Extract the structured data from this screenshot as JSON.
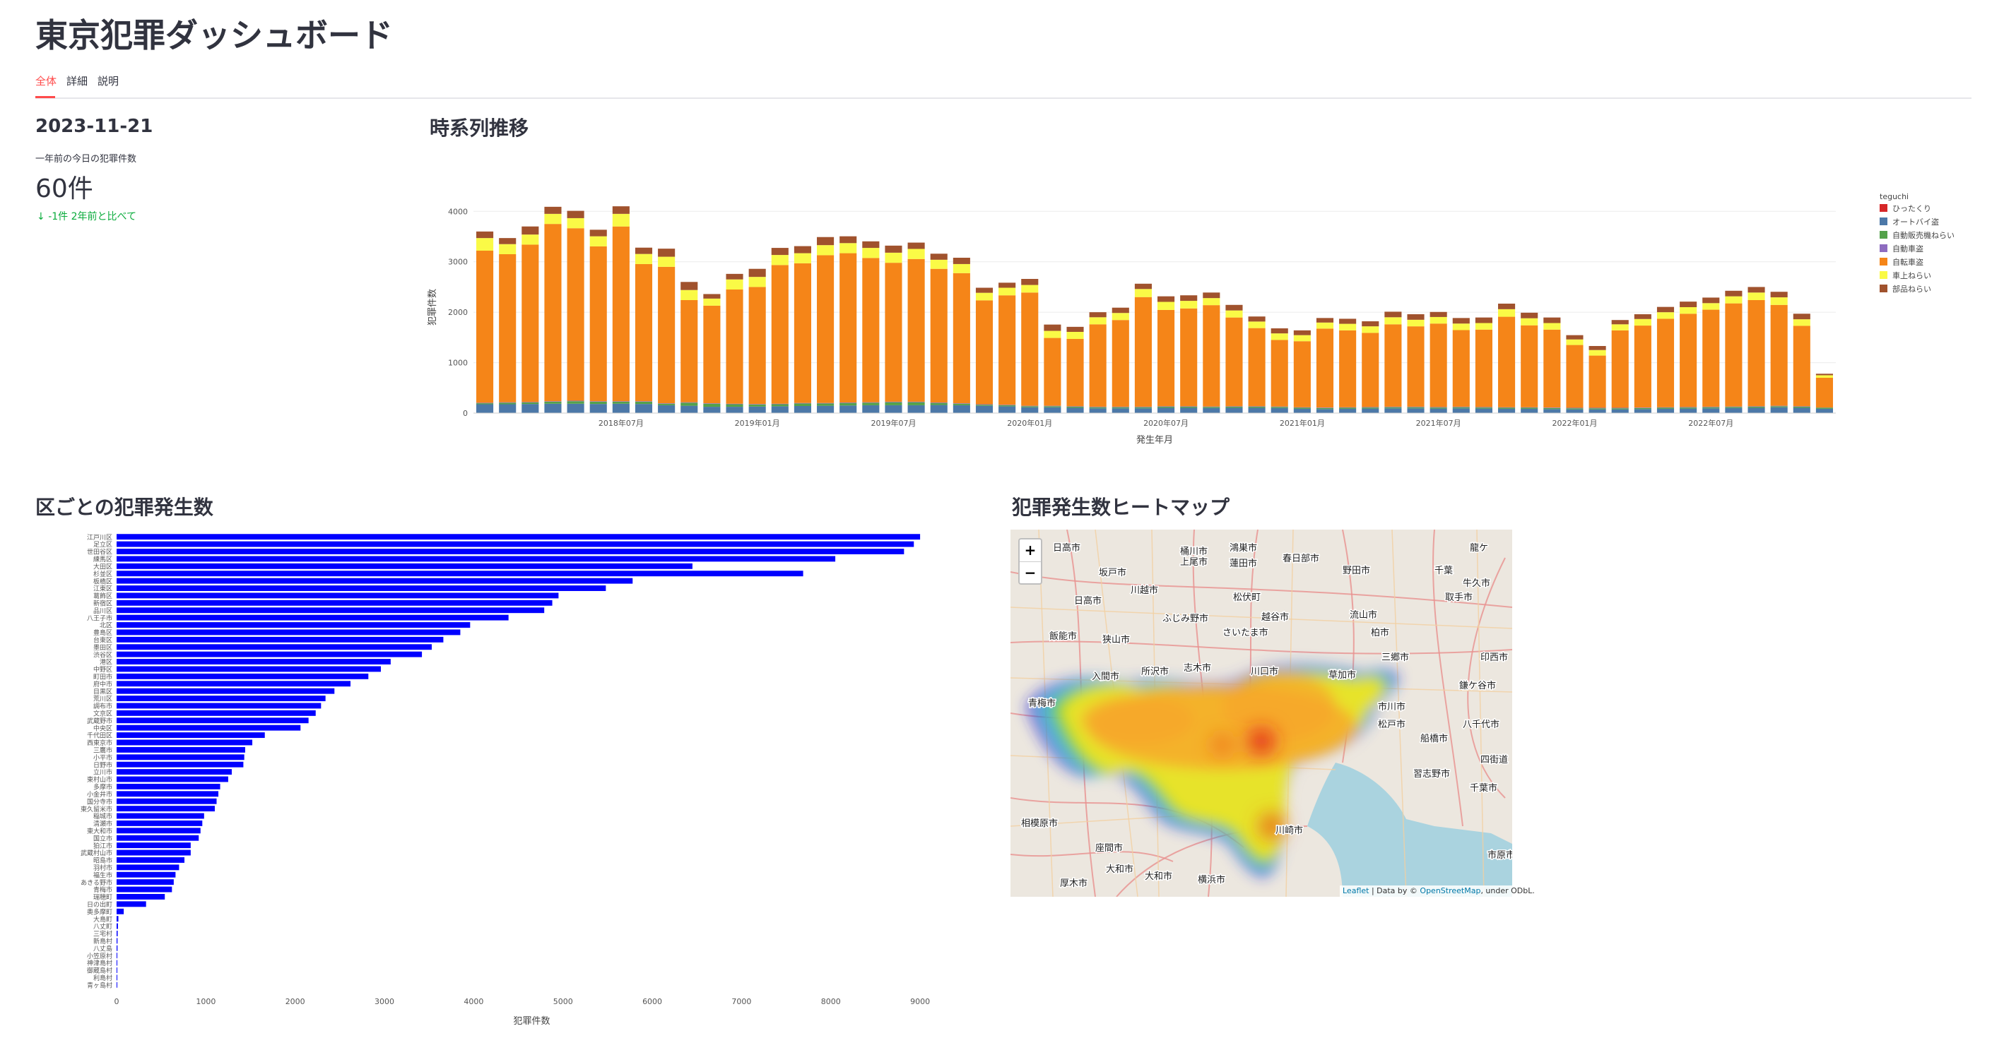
{
  "page": {
    "title": "東京犯罪ダッシュボード"
  },
  "tabs": [
    {
      "label": "全体",
      "active": true
    },
    {
      "label": "詳細",
      "active": false
    },
    {
      "label": "説明",
      "active": false
    }
  ],
  "metric": {
    "date": "2023-11-21",
    "label": "一年前の今日の犯罪件数",
    "value": "60件",
    "delta": "-1件 2年前と比べて",
    "delta_icon": "arrow-down-icon",
    "delta_color": "#09ab3b"
  },
  "sections": {
    "timeseries": "時系列推移",
    "wards": "区ごとの犯罪発生数",
    "heatmap": "犯罪発生数ヒートマップ"
  },
  "chart_data": [
    {
      "type": "bar",
      "stacked": true,
      "xlabel": "発生年月",
      "ylabel": "犯罪件数",
      "ylim": [
        0,
        4200
      ],
      "yticks": [
        0,
        1000,
        2000,
        3000,
        4000
      ],
      "xticks": [
        "2018年07月",
        "2019年01月",
        "2019年07月",
        "2020年01月",
        "2020年07月",
        "2021年01月",
        "2021年07月",
        "2022年01月",
        "2022年07月"
      ],
      "xtick_indices": [
        6,
        12,
        18,
        24,
        30,
        36,
        42,
        48,
        54
      ],
      "legend_title": "teguchi",
      "legend_position": "right",
      "categories": [
        "2018年01月",
        "2018年02月",
        "2018年03月",
        "2018年04月",
        "2018年05月",
        "2018年06月",
        "2018年07月",
        "2018年08月",
        "2018年09月",
        "2018年10月",
        "2018年11月",
        "2018年12月",
        "2019年01月",
        "2019年02月",
        "2019年03月",
        "2019年04月",
        "2019年05月",
        "2019年06月",
        "2019年07月",
        "2019年08月",
        "2019年09月",
        "2019年10月",
        "2019年11月",
        "2019年12月",
        "2020年01月",
        "2020年02月",
        "2020年03月",
        "2020年04月",
        "2020年05月",
        "2020年06月",
        "2020年07月",
        "2020年08月",
        "2020年09月",
        "2020年10月",
        "2020年11月",
        "2020年12月",
        "2021年01月",
        "2021年02月",
        "2021年03月",
        "2021年04月",
        "2021年05月",
        "2021年06月",
        "2021年07月",
        "2021年08月",
        "2021年09月",
        "2021年10月",
        "2021年11月",
        "2021年12月",
        "2022年01月",
        "2022年02月",
        "2022年03月",
        "2022年04月",
        "2022年05月",
        "2022年06月",
        "2022年07月",
        "2022年08月",
        "2022年09月",
        "2022年10月",
        "2022年11月",
        "2022年12月"
      ],
      "series": [
        {
          "name": "ひったくり",
          "color": "#d62728",
          "values": [
            5,
            5,
            5,
            5,
            5,
            5,
            5,
            5,
            5,
            5,
            5,
            5,
            5,
            5,
            5,
            5,
            5,
            5,
            5,
            5,
            5,
            5,
            5,
            5,
            5,
            5,
            5,
            5,
            5,
            5,
            5,
            5,
            5,
            5,
            5,
            5,
            5,
            5,
            5,
            5,
            5,
            5,
            5,
            5,
            5,
            5,
            5,
            5,
            5,
            5,
            5,
            5,
            5,
            5,
            5,
            5,
            5,
            5,
            5,
            5
          ]
        },
        {
          "name": "オートバイ盗",
          "color": "#4c78a8",
          "values": [
            170,
            170,
            175,
            180,
            180,
            175,
            180,
            175,
            150,
            140,
            120,
            120,
            125,
            130,
            135,
            140,
            145,
            150,
            150,
            150,
            155,
            150,
            140,
            130,
            110,
            110,
            100,
            90,
            90,
            90,
            100,
            100,
            95,
            100,
            100,
            95,
            80,
            75,
            80,
            85,
            90,
            90,
            85,
            90,
            85,
            80,
            80,
            75,
            70,
            70,
            70,
            75,
            80,
            85,
            90,
            95,
            100,
            110,
            100,
            80
          ]
        },
        {
          "name": "自動販売機ねらい",
          "color": "#54a24b",
          "values": [
            20,
            30,
            30,
            40,
            50,
            45,
            40,
            45,
            30,
            60,
            60,
            50,
            40,
            40,
            50,
            45,
            50,
            50,
            60,
            60,
            40,
            30,
            20,
            20,
            20,
            20,
            20,
            20,
            20,
            20,
            20,
            20,
            20,
            20,
            20,
            20,
            20,
            20,
            20,
            20,
            20,
            20,
            20,
            20,
            20,
            20,
            20,
            20,
            20,
            20,
            20,
            20,
            20,
            20,
            20,
            20,
            20,
            20,
            20,
            20
          ]
        },
        {
          "name": "自動車盗",
          "color": "#8e6cc0",
          "values": [
            10,
            10,
            10,
            10,
            10,
            10,
            10,
            10,
            10,
            10,
            10,
            10,
            10,
            10,
            10,
            10,
            10,
            10,
            10,
            10,
            10,
            10,
            10,
            10,
            10,
            10,
            10,
            10,
            10,
            10,
            10,
            10,
            10,
            10,
            10,
            10,
            10,
            10,
            10,
            10,
            10,
            10,
            10,
            10,
            10,
            10,
            10,
            10,
            10,
            10,
            10,
            10,
            10,
            10,
            10,
            10,
            10,
            10,
            10,
            5
          ]
        },
        {
          "name": "自転車盗",
          "color": "#f58518",
          "values": [
            3015,
            2935,
            3120,
            3515,
            3420,
            3070,
            3465,
            2720,
            2705,
            2025,
            1935,
            2265,
            2320,
            2750,
            2770,
            2930,
            2960,
            2860,
            2755,
            2830,
            2650,
            2580,
            2060,
            2170,
            2245,
            1345,
            1335,
            1635,
            1720,
            2175,
            1910,
            1940,
            2010,
            1760,
            1550,
            1320,
            1310,
            1565,
            1525,
            1470,
            1635,
            1595,
            1655,
            1520,
            1535,
            1795,
            1625,
            1545,
            1245,
            1035,
            1535,
            1625,
            1755,
            1850,
            1925,
            2045,
            2105,
            2000,
            1595,
            590
          ]
        },
        {
          "name": "車上ねらい",
          "color": "#fafa46",
          "values": [
            250,
            200,
            200,
            200,
            200,
            200,
            250,
            200,
            200,
            200,
            140,
            200,
            200,
            200,
            200,
            200,
            200,
            200,
            200,
            200,
            180,
            180,
            150,
            150,
            150,
            140,
            140,
            140,
            140,
            160,
            160,
            150,
            140,
            140,
            130,
            130,
            120,
            120,
            130,
            130,
            140,
            130,
            130,
            130,
            130,
            150,
            140,
            130,
            110,
            110,
            120,
            130,
            130,
            130,
            130,
            140,
            150,
            150,
            130,
            50
          ]
        },
        {
          "name": "部品ねらい",
          "color": "#a0522d",
          "values": [
            130,
            120,
            160,
            140,
            145,
            130,
            150,
            125,
            160,
            160,
            90,
            110,
            160,
            140,
            140,
            160,
            135,
            130,
            140,
            125,
            120,
            125,
            100,
            100,
            120,
            125,
            100,
            100,
            105,
            105,
            110,
            110,
            110,
            110,
            100,
            100,
            95,
            90,
            100,
            100,
            110,
            110,
            100,
            110,
            110,
            110,
            110,
            110,
            85,
            80,
            85,
            95,
            105,
            110,
            110,
            110,
            110,
            110,
            110,
            30
          ]
        }
      ]
    },
    {
      "type": "bar",
      "orientation": "horizontal",
      "xlabel": "犯罪件数",
      "ylabel": "",
      "xlim": [
        0,
        9300
      ],
      "xticks": [
        0,
        1000,
        2000,
        3000,
        4000,
        5000,
        6000,
        7000,
        8000,
        9000
      ],
      "bar_color": "#0000ff",
      "categories": [
        "江戸川区",
        "足立区",
        "世田谷区",
        "練馬区",
        "大田区",
        "杉並区",
        "板橋区",
        "江東区",
        "葛飾区",
        "新宿区",
        "品川区",
        "八王子市",
        "北区",
        "豊島区",
        "台東区",
        "墨田区",
        "渋谷区",
        "港区",
        "中野区",
        "町田市",
        "府中市",
        "目黒区",
        "荒川区",
        "調布市",
        "文京区",
        "武蔵野市",
        "中央区",
        "千代田区",
        "西東京市",
        "三鷹市",
        "小平市",
        "日野市",
        "立川市",
        "東村山市",
        "多摩市",
        "小金井市",
        "国分寺市",
        "東久留米市",
        "稲城市",
        "清瀬市",
        "東大和市",
        "国立市",
        "狛江市",
        "武蔵村山市",
        "昭島市",
        "羽村市",
        "福生市",
        "あきる野市",
        "青梅市",
        "瑞穂町",
        "日の出町",
        "奥多摩町",
        "大島町",
        "八丈町",
        "三宅村",
        "新島村",
        "八丈島",
        "小笠原村",
        "神津島村",
        "御蔵島村",
        "利島村",
        "青ヶ島村"
      ],
      "values": [
        9000,
        8930,
        8820,
        8050,
        6450,
        7690,
        5780,
        5480,
        4950,
        4880,
        4790,
        4390,
        3960,
        3850,
        3660,
        3530,
        3420,
        3070,
        2960,
        2820,
        2620,
        2440,
        2340,
        2290,
        2230,
        2150,
        2060,
        1660,
        1520,
        1440,
        1430,
        1420,
        1290,
        1250,
        1160,
        1140,
        1120,
        1100,
        980,
        960,
        940,
        920,
        830,
        830,
        760,
        700,
        660,
        640,
        620,
        540,
        330,
        80,
        20,
        15,
        12,
        10,
        10,
        8,
        7,
        6,
        5,
        3
      ]
    }
  ],
  "map": {
    "labels": [
      "日高市",
      "坂戸市",
      "川越市",
      "上尾市",
      "蓮田市",
      "春日部市",
      "野田市",
      "柏市",
      "日高市",
      "狭山市",
      "ふじみ野市",
      "さいたま市",
      "越谷市",
      "流山市",
      "取手市",
      "飯能市",
      "入間市",
      "所沢市",
      "志木市",
      "川口市",
      "草加市",
      "三郷市",
      "松戸市",
      "鎌ケ谷市",
      "印西市",
      "青梅市",
      "八千代市",
      "市川市",
      "船橋市",
      "習志野市",
      "千葉市",
      "四街道",
      "相模原市",
      "座間市",
      "川崎市",
      "横浜市",
      "市原市",
      "厚木市",
      "大和市",
      "大和市",
      "桶川市",
      "鴻巣市",
      "牛久市",
      "龍ケ",
      "松伏町",
      "千葉"
    ],
    "zoom_in": "+",
    "zoom_out": "−",
    "attribution_leaflet": "Leaflet",
    "attribution_text": "| Data by ©",
    "attribution_osm": "OpenStreetMap",
    "attribution_rest": ", under ODbL."
  }
}
